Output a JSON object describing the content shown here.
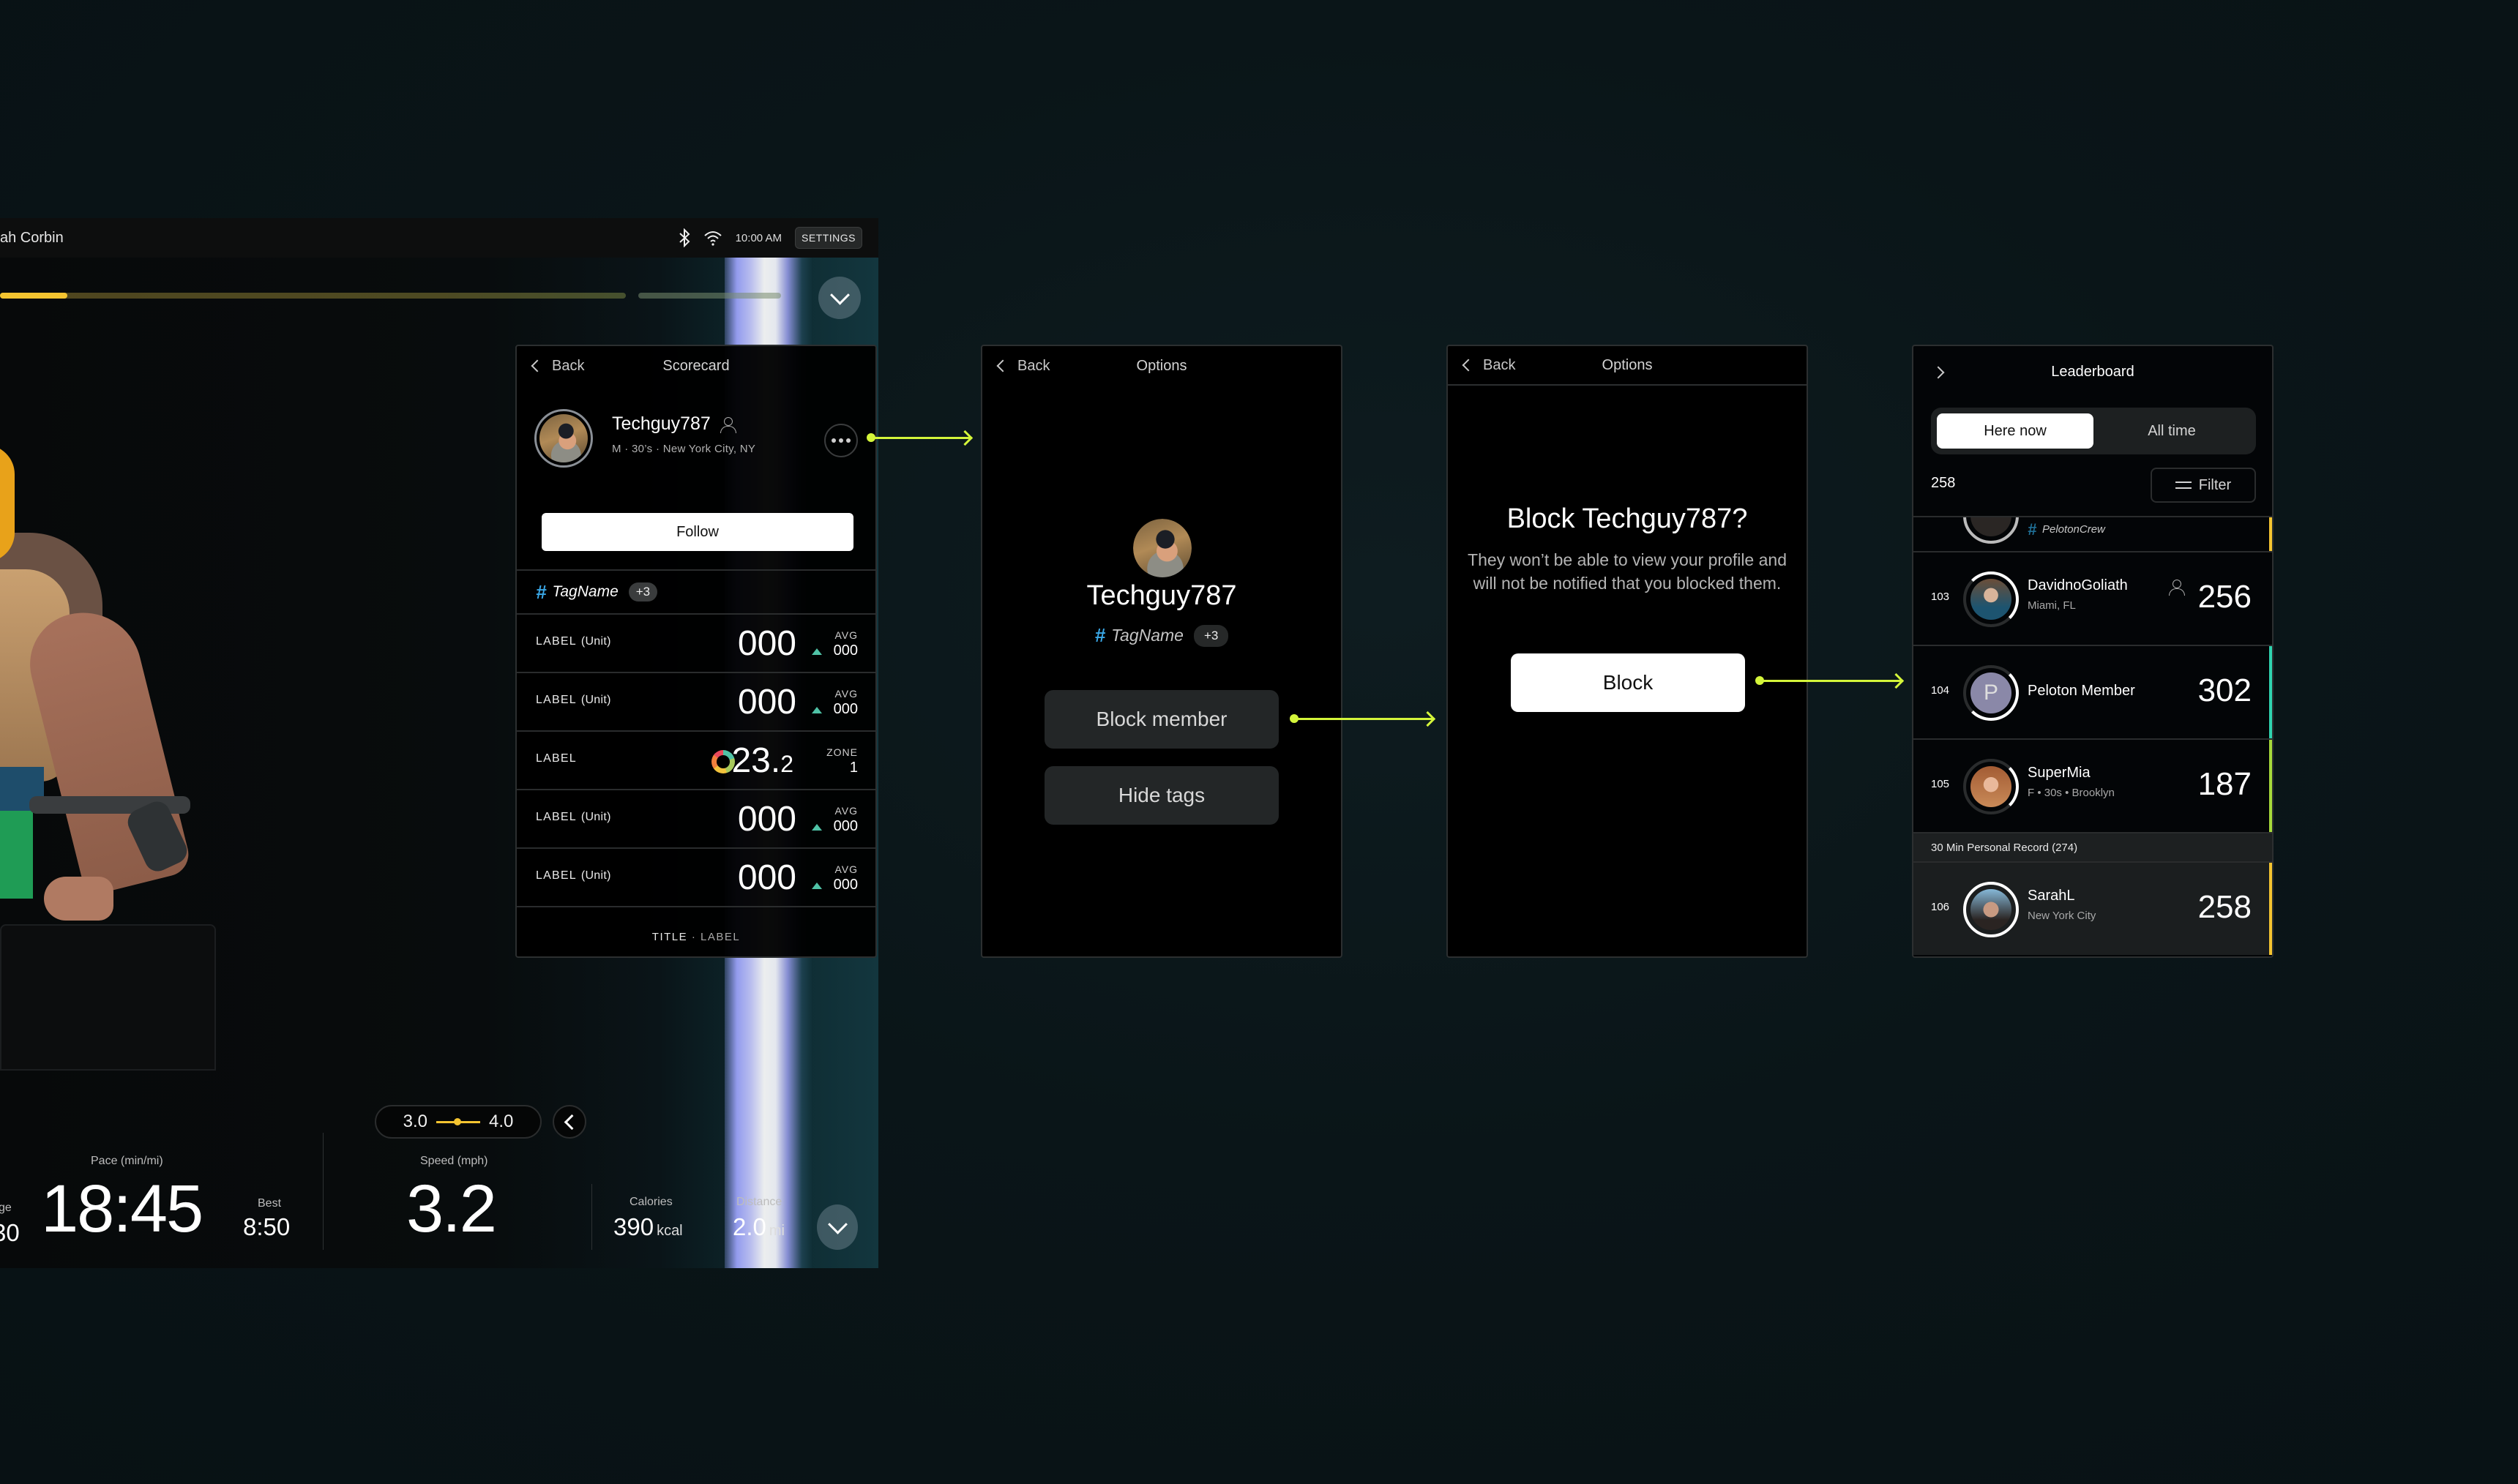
{
  "workout": {
    "instructor": "ah Corbin",
    "status": {
      "time": "10:00 AM",
      "settings_label": "SETTINGS",
      "bluetooth_icon": "bluetooth-icon",
      "wifi_icon": "wifi-icon"
    },
    "progress": {
      "segment_1_fraction": 0.12,
      "accent": "#f4c430"
    },
    "pace_range": {
      "low": "3.0",
      "high": "4.0"
    },
    "metrics": {
      "avg_label_partial": "ge",
      "avg_value_partial": "30",
      "pace_label": "Pace (min/mi)",
      "pace_value": "18:45",
      "best_label": "Best",
      "best_value": "8:50",
      "speed_label": "Speed (mph)",
      "speed_value": "3.2",
      "calories_label": "Calories",
      "calories_value": "390",
      "calories_unit": "kcal",
      "distance_label": "Distance",
      "distance_value": "2.0",
      "distance_unit": "mi"
    }
  },
  "scorecard": {
    "back_label": "Back",
    "title": "Scorecard",
    "user": {
      "name": "Techguy787",
      "meta": "M  ·  30’s  ·  New York City, NY"
    },
    "follow_label": "Follow",
    "tag": {
      "name": "TagName",
      "more": "+3"
    },
    "rows": [
      {
        "label": "LABEL",
        "unit": "(Unit)",
        "value": "000",
        "avg_label": "AVG",
        "avg_value": "000"
      },
      {
        "label": "LABEL",
        "unit": "(Unit)",
        "value": "000",
        "avg_label": "AVG",
        "avg_value": "000"
      },
      {
        "label": "LABEL",
        "unit": "",
        "value_main": "23.",
        "value_dec": "2",
        "zone_label": "ZONE",
        "zone_value": "1"
      },
      {
        "label": "LABEL",
        "unit": "(Unit)",
        "value": "000",
        "avg_label": "AVG",
        "avg_value": "000"
      },
      {
        "label": "LABEL",
        "unit": "(Unit)",
        "value": "000",
        "avg_label": "AVG",
        "avg_value": "000"
      }
    ],
    "footer": {
      "title": "TITLE",
      "sep": "·",
      "label": "LABEL"
    }
  },
  "options": {
    "back_label": "Back",
    "title": "Options",
    "user_name": "Techguy787",
    "tag": {
      "name": "TagName",
      "more": "+3"
    },
    "block_label": "Block member",
    "hide_tags_label": "Hide tags"
  },
  "confirm": {
    "back_label": "Back",
    "title": "Options",
    "heading": "Block Techguy787?",
    "body": "They won’t be able to view your profile and will not be notified that you blocked them.",
    "block_label": "Block"
  },
  "leaderboard": {
    "title": "Leaderboard",
    "tabs": [
      {
        "label": "Here now",
        "active": true
      },
      {
        "label": "All time",
        "active": false
      }
    ],
    "count": "258",
    "filter_label": "Filter",
    "partial_tag": "PelotonCrew",
    "rows": [
      {
        "rank": "103",
        "name": "DavidnoGoliath",
        "sub": "Miami, FL",
        "score": "256",
        "following": true,
        "edge": ""
      },
      {
        "rank": "104",
        "name": "Peloton Member",
        "sub": "",
        "initial": "P",
        "score": "302",
        "edge": "#2fd3b0"
      },
      {
        "rank": "105",
        "name": "SuperMia",
        "sub": "F • 30s • Brooklyn",
        "score": "187",
        "edge": "#a6d93a"
      }
    ],
    "pr_label": "30 Min Personal Record (274)",
    "me": {
      "rank": "106",
      "name": "SarahL",
      "sub": "New York City",
      "score": "258",
      "edge": "#f4c430"
    }
  },
  "colors": {
    "flow_arrow": "#d4f53a",
    "tag_hash": "#3aa7e6",
    "avg_up": "#4fc2a6"
  }
}
